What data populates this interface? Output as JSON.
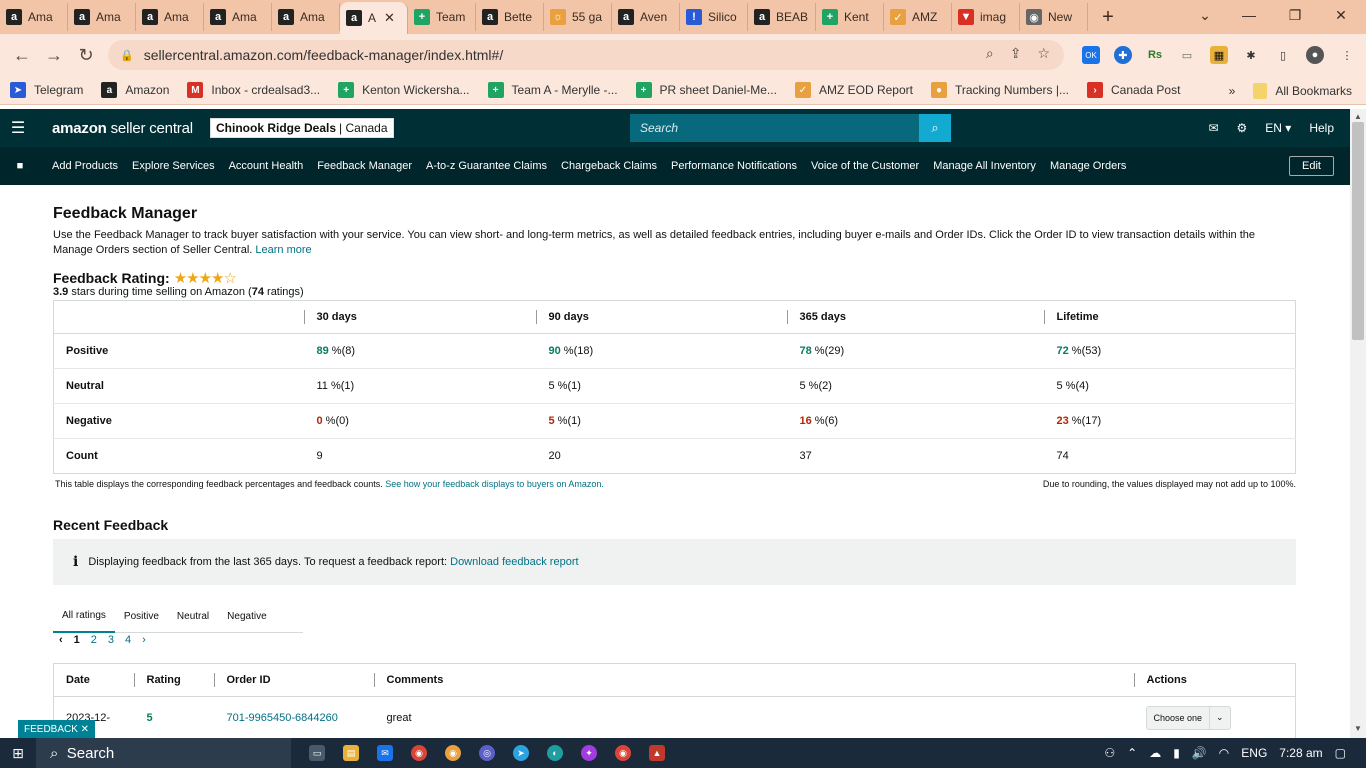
{
  "browser": {
    "tabs": [
      {
        "label": "Ama",
        "favicon": "a"
      },
      {
        "label": "Ama",
        "favicon": "a"
      },
      {
        "label": "Ama",
        "favicon": "a"
      },
      {
        "label": "Ama",
        "favicon": "a"
      },
      {
        "label": "Ama",
        "favicon": "a"
      },
      {
        "label": "A",
        "favicon": "a"
      },
      {
        "label": "Team",
        "favicon": "+"
      },
      {
        "label": "Bette",
        "favicon": "a"
      },
      {
        "label": "55 ga",
        "favicon": "☼"
      },
      {
        "label": "Aven",
        "favicon": "a"
      },
      {
        "label": "Silico",
        "favicon": "!"
      },
      {
        "label": "BEAB",
        "favicon": "a"
      },
      {
        "label": "Kent",
        "favicon": "+"
      },
      {
        "label": "AMZ",
        "favicon": "✓"
      },
      {
        "label": "imag",
        "favicon": "▼"
      },
      {
        "label": "New",
        "favicon": "◉"
      }
    ],
    "new_tab": "+",
    "url": "sellercentral.amazon.com/feedback-manager/index.html#/",
    "ext_ok": "OK",
    "ext_rs": "Rs",
    "bookmarks": [
      {
        "label": "Telegram",
        "favicon": "➤"
      },
      {
        "label": "Amazon",
        "favicon": "a"
      },
      {
        "label": "Inbox - crdealsad3...",
        "favicon": "M"
      },
      {
        "label": "Kenton Wickersha...",
        "favicon": "+"
      },
      {
        "label": "Team A - Merylle -...",
        "favicon": "+"
      },
      {
        "label": "PR sheet Daniel-Me...",
        "favicon": "+"
      },
      {
        "label": "AMZ EOD Report",
        "favicon": "✓"
      },
      {
        "label": "Tracking Numbers |...",
        "favicon": "●"
      },
      {
        "label": "Canada Post",
        "favicon": "›"
      }
    ],
    "bookmarks_overflow": "»",
    "all_bookmarks": "All Bookmarks"
  },
  "header": {
    "logo_bold": "amazon",
    "logo_rest": " seller central",
    "store_name": "Chinook Ridge Deals",
    "store_region": "| Canada",
    "search_placeholder": "Search",
    "language": "EN",
    "help": "Help"
  },
  "nav": {
    "links": [
      "Add Products",
      "Explore Services",
      "Account Health",
      "Feedback Manager",
      "A-to-z Guarantee Claims",
      "Chargeback Claims",
      "Performance Notifications",
      "Voice of the Customer",
      "Manage All Inventory",
      "Manage Orders"
    ],
    "edit": "Edit"
  },
  "page": {
    "title": "Feedback Manager",
    "description": "Use the Feedback Manager to track buyer satisfaction with your service. You can view short- and long-term metrics, as well as detailed feedback entries, including buyer e-mails and Order IDs. Click the Order ID to view transaction details within the Manage Orders section of Seller Central.",
    "learn_more": "Learn more",
    "rating_title": "Feedback Rating:",
    "rating_value": 3.9,
    "rating_stars": "★★★★☆",
    "rating_sub_pre": "3.9",
    "rating_sub_mid": " stars during time selling on Amazon (",
    "rating_sub_count": "74",
    "rating_sub_post": " ratings)"
  },
  "feedback_table": {
    "headers": [
      "30 days",
      "90 days",
      "365 days",
      "Lifetime"
    ],
    "rows": [
      {
        "label": "Positive",
        "cells": [
          {
            "pct": "89",
            "rest": " %(8)"
          },
          {
            "pct": "90",
            "rest": " %(18)"
          },
          {
            "pct": "78",
            "rest": " %(29)"
          },
          {
            "pct": "72",
            "rest": " %(53)"
          }
        ]
      },
      {
        "label": "Neutral",
        "cells": [
          {
            "pct": "11",
            "rest": " %(1)"
          },
          {
            "pct": "5",
            "rest": " %(1)"
          },
          {
            "pct": "5",
            "rest": " %(2)"
          },
          {
            "pct": "5",
            "rest": " %(4)"
          }
        ]
      },
      {
        "label": "Negative",
        "cells": [
          {
            "pct": "0",
            "rest": " %(0)"
          },
          {
            "pct": "5",
            "rest": " %(1)"
          },
          {
            "pct": "16",
            "rest": " %(6)"
          },
          {
            "pct": "23",
            "rest": " %(17)"
          }
        ]
      },
      {
        "label": "Count",
        "cells": [
          {
            "pct": "9",
            "rest": ""
          },
          {
            "pct": "20",
            "rest": ""
          },
          {
            "pct": "37",
            "rest": ""
          },
          {
            "pct": "74",
            "rest": ""
          }
        ]
      }
    ],
    "footnote_left": "This table displays the corresponding feedback percentages and feedback counts.",
    "footnote_link": "See how your feedback displays to buyers on Amazon.",
    "footnote_right": "Due to rounding, the values displayed may not add up to 100%."
  },
  "recent": {
    "title": "Recent Feedback",
    "info_text": "Displaying feedback from the last 365 days. To request a feedback report:",
    "info_link": "Download feedback report",
    "tabs": [
      "All ratings",
      "Positive",
      "Neutral",
      "Negative"
    ],
    "pages": [
      "1",
      "2",
      "3",
      "4"
    ],
    "prev": "‹",
    "next": "›",
    "headers": [
      "Date",
      "Rating",
      "Order ID",
      "Comments",
      "Actions"
    ],
    "rows": [
      {
        "date": "2023-12-",
        "rating": "5",
        "order_id": "701-9965450-6844260",
        "comment": "great",
        "action": "Choose one"
      }
    ]
  },
  "feedback_tag": "FEEDBACK ✕",
  "taskbar": {
    "search": "Search",
    "language": "ENG",
    "time": "7:28 am"
  },
  "colors": {
    "header_bg": "#002f36",
    "nav_bg": "#00252a",
    "link": "#007185",
    "positive": "#067d62",
    "negative": "#b12704",
    "tab_strip": "#f2c5a8"
  }
}
